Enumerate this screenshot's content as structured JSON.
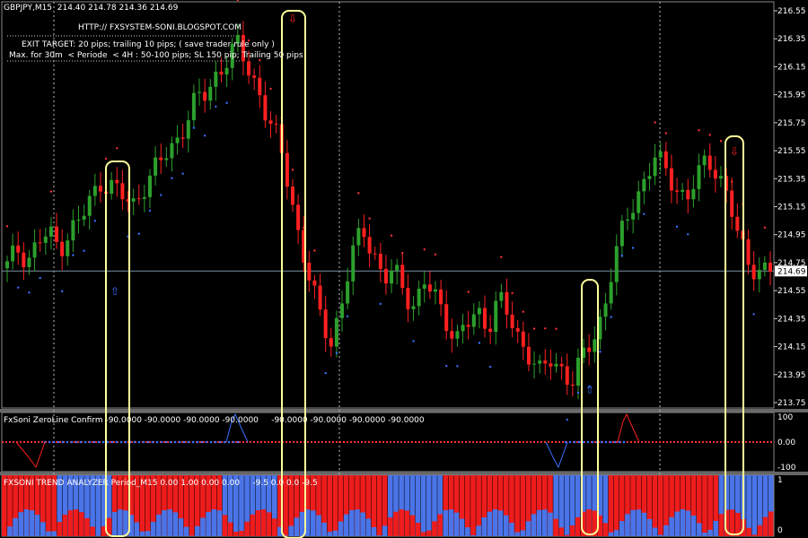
{
  "main_panel": {
    "header": "GBPJPY,M15  214.40 214.78 214.36 214.69",
    "url_text": "HTTP:// FXSYSTEM-SONI.BLOGSPOT.COM",
    "note_line1": "EXIT TARGET: 20 pips; trailing 10 pips; ( save trader rule only )",
    "note_line2": "Max. for 30m  < Periode  < 4H : 50-100 pips; SL 150 pip; Trailing 50 pips",
    "price_ticks": [
      "216.55",
      "216.35",
      "216.15",
      "215.95",
      "215.75",
      "215.55",
      "215.35",
      "215.15",
      "214.95",
      "214.75",
      "214.55",
      "214.35",
      "214.15",
      "213.95",
      "213.75"
    ],
    "current_price": "214.69"
  },
  "zeroline_panel": {
    "header": "FxSoni ZeroLine Confirm -90.0000 -90.0000 -90.0000 -90.0000     -90.0000 -90.0000 -90.0000 -90.0000",
    "ticks": [
      "100",
      "0.00",
      "-100"
    ]
  },
  "trend_panel": {
    "header": "FXSONI TREND ANALYZER Period_M15 0.00 1.00 0.00 0.00     -9.5 0.0 0.0 -9.5",
    "ticks": [
      "1",
      "0"
    ]
  },
  "colors": {
    "bull": "#2ca02c",
    "bear": "#ff2020",
    "dot_blue": "#3a6fff",
    "dot_red": "#ff3030",
    "highlight": "#ffff99",
    "trend_blue": "#4a74e8",
    "trend_red": "#ee1c1c"
  },
  "chart_data": {
    "type": "candlestick",
    "symbol": "GBPJPY",
    "timeframe": "M15",
    "ylim": [
      213.7,
      216.6
    ],
    "closes": [
      214.72,
      214.85,
      214.78,
      214.9,
      214.95,
      214.86,
      214.98,
      215.05,
      215.2,
      215.34,
      215.3,
      215.22,
      215.15,
      215.3,
      215.4,
      215.5,
      215.6,
      215.75,
      215.9,
      215.95,
      216.1,
      216.2,
      216.3,
      216.15,
      216.0,
      215.75,
      215.6,
      215.3,
      214.9,
      214.6,
      214.35,
      214.2,
      214.45,
      214.8,
      215.0,
      214.85,
      214.6,
      214.7,
      214.55,
      214.45,
      214.6,
      214.5,
      214.35,
      214.2,
      214.3,
      214.4,
      214.3,
      214.5,
      214.35,
      214.2,
      214.1,
      213.95,
      214.05,
      214.0,
      213.9,
      214.05,
      214.2,
      214.4,
      214.75,
      215.0,
      215.2,
      215.35,
      215.5,
      215.4,
      215.3,
      215.2,
      215.35,
      215.5,
      215.4,
      215.2,
      214.9,
      214.75,
      214.7,
      214.69
    ],
    "signals": [
      {
        "type": "buy",
        "price": 214.55
      },
      {
        "type": "sell",
        "price": 216.5
      },
      {
        "type": "buy",
        "price": 213.85
      },
      {
        "type": "sell",
        "price": 215.55
      }
    ]
  }
}
